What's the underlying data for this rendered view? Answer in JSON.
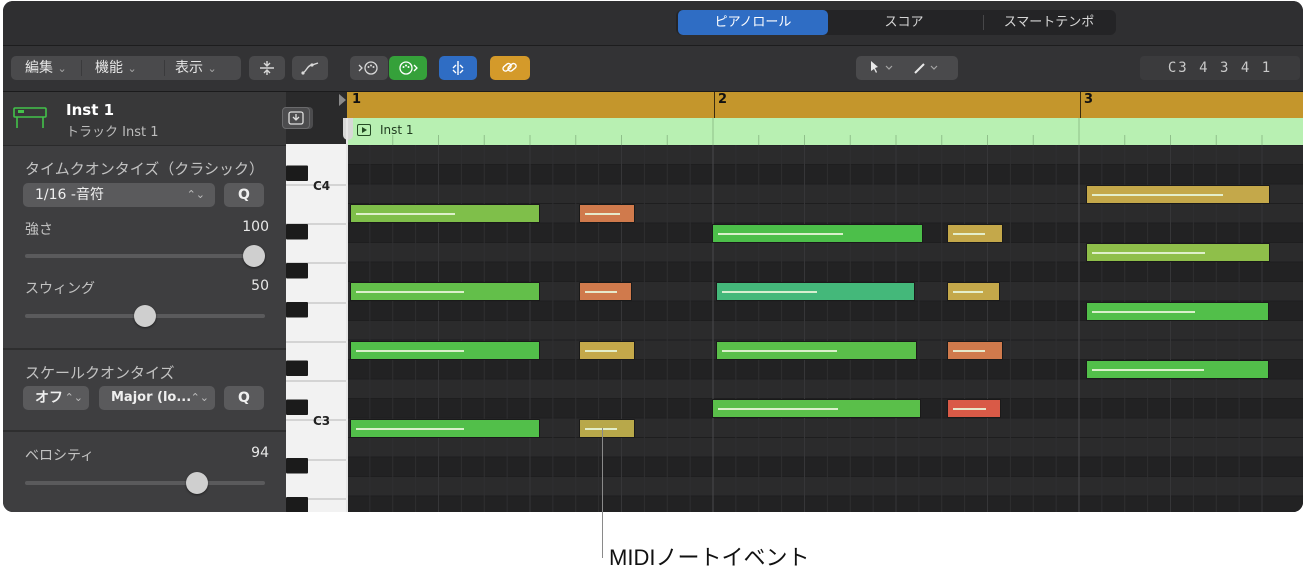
{
  "view_tabs": [
    {
      "label": "ピアノロール",
      "active": true
    },
    {
      "label": "スコア",
      "active": false
    },
    {
      "label": "スマートテンポ",
      "active": false
    }
  ],
  "toolbar": {
    "menus": [
      "編集",
      "機能",
      "表示"
    ],
    "position_display": "C3  4 3 4 1",
    "icons": [
      "collapse-icon",
      "automation-curve-icon",
      "midi-in-icon",
      "midi-out-icon",
      "catch-playhead-icon",
      "link-icon",
      "pointer-tool-icon",
      "pencil-tool-icon"
    ]
  },
  "track": {
    "name": "Inst 1",
    "subtitle": "トラック Inst 1"
  },
  "inspector": {
    "time_quantize": {
      "title": "タイムクオンタイズ（クラシック）",
      "value": "1/16 -音符",
      "q_label": "Q",
      "strength_label": "強さ",
      "strength_value": "100",
      "strength_level": 1.0,
      "swing_label": "スウィング",
      "swing_value": "50",
      "swing_level": 0.5
    },
    "scale_quantize": {
      "title": "スケールクオンタイズ",
      "off_label": "オフ",
      "scale_label": "Major (lo...",
      "q_label": "Q"
    },
    "velocity": {
      "label": "ベロシティ",
      "value": "94",
      "level": 0.74
    }
  },
  "piano_keys": {
    "c4_label": "C4",
    "c3_label": "C3"
  },
  "ruler": {
    "bars": [
      "1",
      "2",
      "3"
    ]
  },
  "region": {
    "name": "Inst 1",
    "color": "#b8f0b2"
  },
  "callout": {
    "text": "MIDIノートイベント"
  },
  "colors": {
    "accent": "#2f6dc4",
    "ruler": "#c4962c",
    "note_green": "#6cc04a",
    "note_yellow": "#c4a84a",
    "note_orange": "#d07a4c",
    "note_red": "#d95a47"
  },
  "notes": [
    {
      "bar": 1.0,
      "len": 0.52,
      "pitch": 59,
      "vel": 0.55,
      "color": "#7fbf4a"
    },
    {
      "bar": 1.625,
      "len": 0.155,
      "pitch": 59,
      "vel": 0.75,
      "color": "#d07a4c"
    },
    {
      "bar": 1.0,
      "len": 0.52,
      "pitch": 55,
      "vel": 0.6,
      "color": "#63bf4a"
    },
    {
      "bar": 1.625,
      "len": 0.145,
      "pitch": 55,
      "vel": 0.75,
      "color": "#d07a4c"
    },
    {
      "bar": 1.0,
      "len": 0.52,
      "pitch": 52,
      "vel": 0.6,
      "color": "#52bf4a"
    },
    {
      "bar": 1.625,
      "len": 0.155,
      "pitch": 52,
      "vel": 0.7,
      "color": "#c4a84a"
    },
    {
      "bar": 1.0,
      "len": 0.52,
      "pitch": 48,
      "vel": 0.6,
      "color": "#52bf4a"
    },
    {
      "bar": 1.625,
      "len": 0.155,
      "pitch": 48,
      "vel": 0.7,
      "color": "#b8a84a"
    },
    {
      "bar": 1.99,
      "len": 0.575,
      "pitch": 58,
      "vel": 0.62,
      "color": "#4cbf4a"
    },
    {
      "bar": 2.63,
      "len": 0.155,
      "pitch": 58,
      "vel": 0.7,
      "color": "#c4a84a"
    },
    {
      "bar": 2.0,
      "len": 0.545,
      "pitch": 55,
      "vel": 0.5,
      "color": "#44b87a"
    },
    {
      "bar": 2.63,
      "len": 0.145,
      "pitch": 55,
      "vel": 0.7,
      "color": "#c4a84a"
    },
    {
      "bar": 2.0,
      "len": 0.55,
      "pitch": 52,
      "vel": 0.6,
      "color": "#5abf4a"
    },
    {
      "bar": 2.63,
      "len": 0.155,
      "pitch": 52,
      "vel": 0.7,
      "color": "#d07a4c"
    },
    {
      "bar": 1.99,
      "len": 0.57,
      "pitch": 49,
      "vel": 0.6,
      "color": "#5abf4a"
    },
    {
      "bar": 2.63,
      "len": 0.15,
      "pitch": 49,
      "vel": 0.75,
      "color": "#d95a47"
    },
    {
      "bar": 3.01,
      "len": 0.505,
      "pitch": 60,
      "vel": 0.75,
      "color": "#c4a84a"
    },
    {
      "bar": 3.01,
      "len": 0.505,
      "pitch": 57,
      "vel": 0.65,
      "color": "#8fbf4a"
    },
    {
      "bar": 3.01,
      "len": 0.5,
      "pitch": 54,
      "vel": 0.6,
      "color": "#52bf4a"
    },
    {
      "bar": 3.01,
      "len": 0.5,
      "pitch": 51,
      "vel": 0.65,
      "color": "#52bf4a"
    }
  ]
}
